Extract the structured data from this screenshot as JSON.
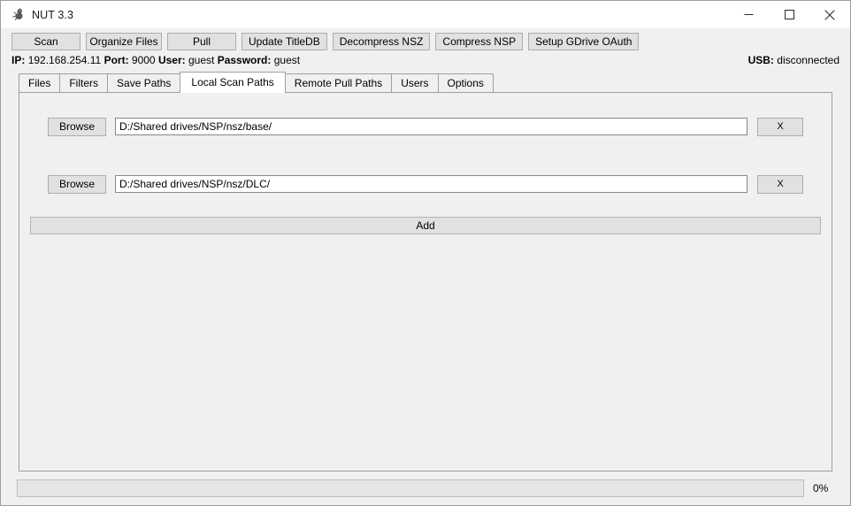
{
  "window": {
    "title": "NUT 3.3",
    "app_icon": "squirrel-icon",
    "controls": {
      "minimize": "minimize-icon",
      "maximize": "maximize-icon",
      "close": "close-icon"
    }
  },
  "toolbar": {
    "buttons": [
      {
        "label": "Scan",
        "name": "scan-button"
      },
      {
        "label": "Organize Files",
        "name": "organize-files-button"
      },
      {
        "label": "Pull",
        "name": "pull-button"
      },
      {
        "label": "Update TitleDB",
        "name": "update-titledb-button"
      },
      {
        "label": "Decompress NSZ",
        "name": "decompress-nsz-button"
      },
      {
        "label": "Compress NSP",
        "name": "compress-nsp-button"
      },
      {
        "label": "Setup GDrive OAuth",
        "name": "setup-gdrive-oauth-button"
      }
    ]
  },
  "status": {
    "ip_label": "IP:",
    "ip_value": "192.168.254.11",
    "port_label": "Port:",
    "port_value": "9000",
    "user_label": "User:",
    "user_value": "guest",
    "password_label": "Password:",
    "password_value": "guest",
    "connection_line": "IP: 192.168.254.11 Port: 9000 User: guest Password: guest",
    "usb_label": "USB:",
    "usb_value": "disconnected"
  },
  "tabs": [
    {
      "label": "Files",
      "active": false
    },
    {
      "label": "Filters",
      "active": false
    },
    {
      "label": "Save Paths",
      "active": false
    },
    {
      "label": "Local Scan Paths",
      "active": true
    },
    {
      "label": "Remote Pull Paths",
      "active": false
    },
    {
      "label": "Users",
      "active": false
    },
    {
      "label": "Options",
      "active": false
    }
  ],
  "local_scan_paths": {
    "rows": [
      {
        "browse_label": "Browse",
        "path_value": "D:/Shared drives/NSP/nsz/base/",
        "path_placeholder": "",
        "delete_label": "X"
      },
      {
        "browse_label": "Browse",
        "path_value": "D:/Shared drives/NSP/nsz/DLC/",
        "path_placeholder": "",
        "delete_label": "X"
      }
    ],
    "add_label": "Add"
  },
  "progress": {
    "percent_label": "0%",
    "percent_value": 0
  },
  "colors": {
    "window_bg": "#f0f0f0",
    "titlebar_bg": "#ffffff",
    "button_bg": "#e1e1e1",
    "button_border": "#adadad",
    "panel_border": "#a0a0a0",
    "input_bg": "#ffffff",
    "input_border": "#828790",
    "text": "#000000"
  }
}
